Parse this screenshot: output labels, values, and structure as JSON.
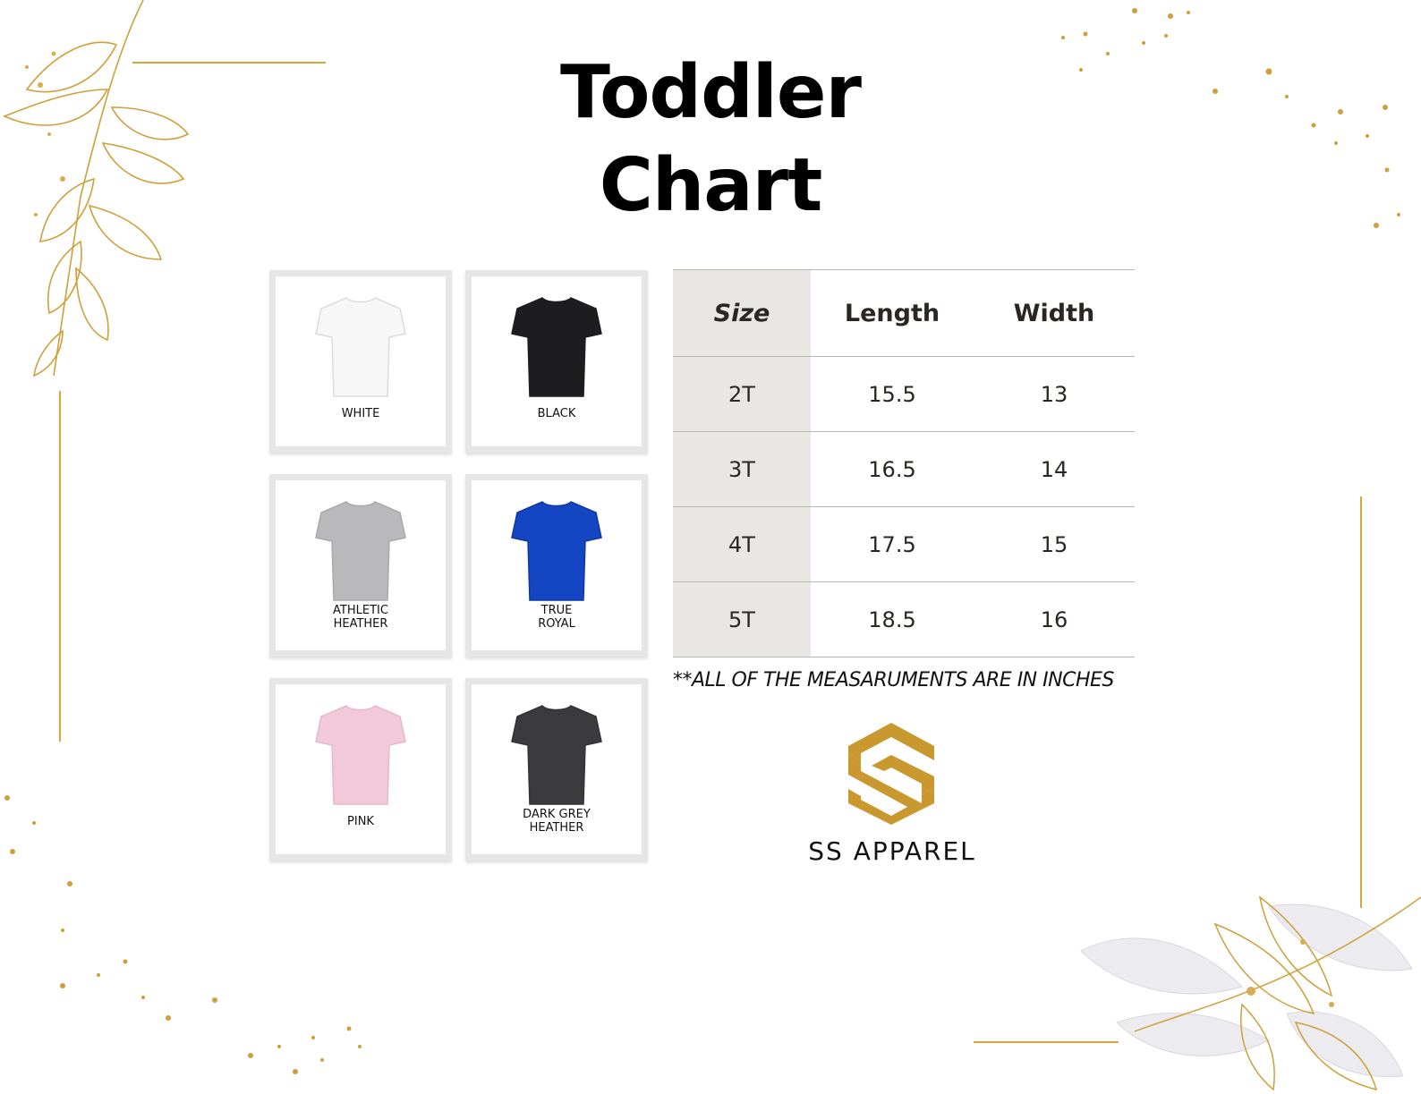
{
  "title": {
    "line1": "Toddler",
    "line2": "Chart"
  },
  "swatches": [
    {
      "label": "WHITE",
      "color": "#f7f7f7",
      "stroke": "#dcdcdc"
    },
    {
      "label": "BLACK",
      "color": "#1d1d1f",
      "stroke": "#1d1d1f"
    },
    {
      "label": "ATHLETIC\nHEATHER",
      "color": "#b9b9bb",
      "stroke": "#a9a9ab"
    },
    {
      "label": "TRUE\nROYAL",
      "color": "#1445c2",
      "stroke": "#0f38a3"
    },
    {
      "label": "PINK",
      "color": "#f2c9d8",
      "stroke": "#e6b8c9"
    },
    {
      "label": "DARK GREY\nHEATHER",
      "color": "#3b3b3d",
      "stroke": "#333335"
    }
  ],
  "table": {
    "headers": {
      "size": "Size",
      "length": "Length",
      "width": "Width"
    },
    "rows": [
      {
        "size": "2T",
        "length": "15.5",
        "width": "13"
      },
      {
        "size": "3T",
        "length": "16.5",
        "width": "14"
      },
      {
        "size": "4T",
        "length": "17.5",
        "width": "15"
      },
      {
        "size": "5T",
        "length": "18.5",
        "width": "16"
      }
    ]
  },
  "note": "**ALL OF THE MEASARUMENTS ARE IN INCHES",
  "brand": {
    "name": "SS APPAREL",
    "logo_color": "#c9982f"
  },
  "colors": {
    "gold": "#d4a63c",
    "table_shade": "#e8e7e4",
    "table_text": "#2b2623"
  }
}
